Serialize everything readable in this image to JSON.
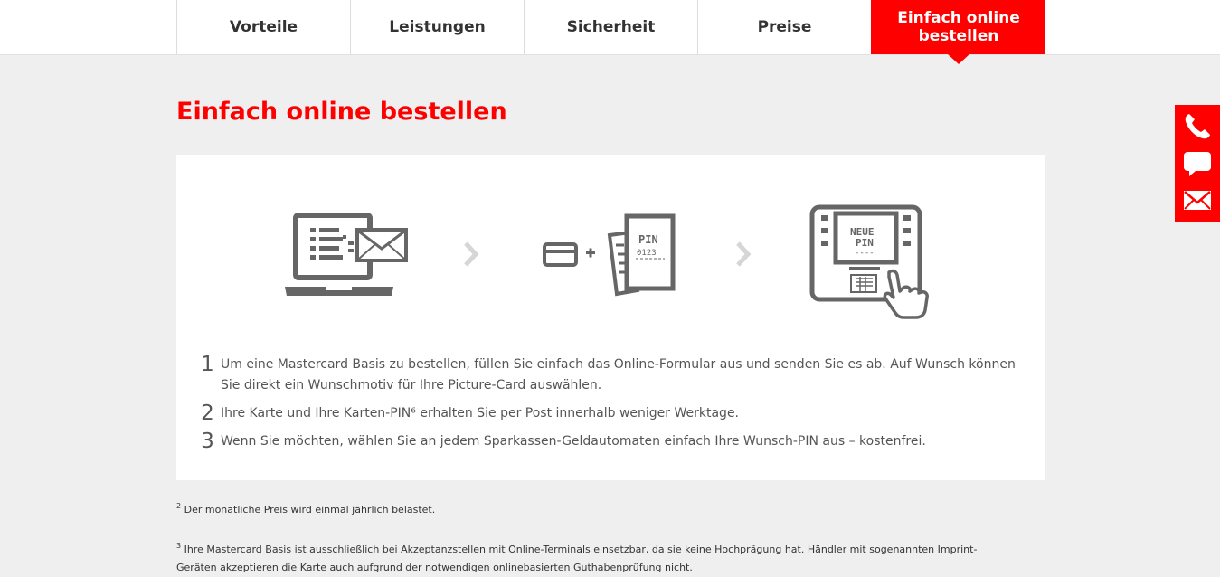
{
  "nav": {
    "tabs": [
      {
        "label": "Vorteile"
      },
      {
        "label": "Leistungen"
      },
      {
        "label": "Sicherheit"
      },
      {
        "label": "Preise"
      },
      {
        "label": "Einfach online bestellen"
      }
    ]
  },
  "section": {
    "title": "Einfach online bestellen"
  },
  "illustrations": {
    "pin_label": "PIN",
    "pin_digits": "0123",
    "atm_line1": "NEUE",
    "atm_line2": "PIN",
    "atm_line3": "----",
    "plus": "+"
  },
  "steps": [
    {
      "number": "1",
      "text": "Um eine Mastercard Basis zu bestellen, füllen Sie einfach das Online-Formular aus und senden Sie es ab. Auf Wunsch können Sie direkt ein Wunschmotiv für Ihre Picture-Card auswählen."
    },
    {
      "number": "2",
      "text": "Ihre Karte und Ihre Karten-PIN⁶ erhalten Sie per Post innerhalb weniger Werktage."
    },
    {
      "number": "3",
      "text": "Wenn Sie möchten, wählen Sie an jedem Sparkassen-Geldautomaten einfach Ihre Wunsch-PIN aus – kostenfrei."
    }
  ],
  "footnotes": [
    {
      "mark": "2",
      "text": "Der monatliche Preis wird einmal jährlich belastet."
    },
    {
      "mark": "3",
      "text": "Ihre Mastercard Basis ist ausschließlich bei Akzeptanzstellen mit Online-Terminals einsetzbar, da sie keine Hochprägung hat. Händler mit sogenannten Imprint-Geräten akzeptieren die Karte auch aufgrund der notwendigen onlinebasierten Guthabenprüfung nicht."
    }
  ],
  "colors": {
    "accent": "#ff0000",
    "icon_gray": "#666666"
  },
  "icons": {
    "side": [
      "phone-icon",
      "chat-icon",
      "mail-icon"
    ]
  }
}
